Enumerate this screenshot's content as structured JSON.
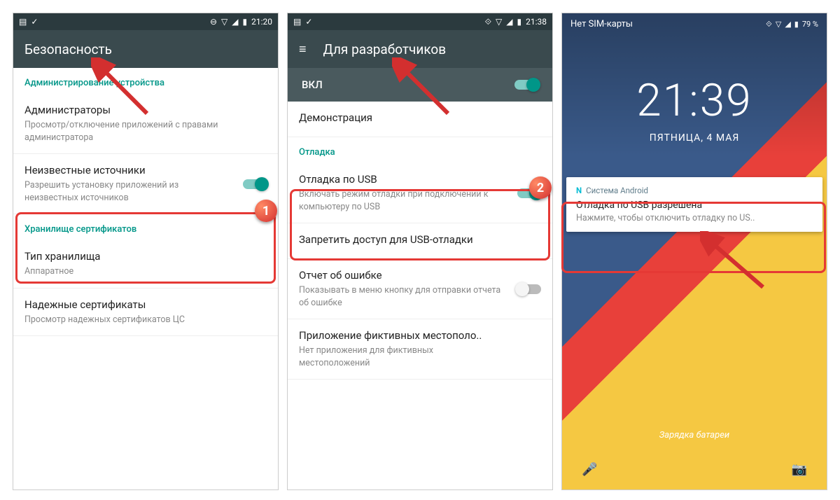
{
  "phone1": {
    "statusbar_time": "21:20",
    "header_title": "Безопасность",
    "section1": "Администрирование устройства",
    "item1_title": "Администраторы",
    "item1_sub": "Просмотр/отключение приложений с правами администратора",
    "item2_title": "Неизвестные источники",
    "item2_sub": "Разрешить установку приложений из неизвестных источников",
    "section2": "Хранилище сертификатов",
    "item3_title": "Тип хранилища",
    "item3_sub": "Аппаратное",
    "item4_title": "Надежные сертификаты",
    "item4_sub": "Просмотр надежных сертификатов ЦС"
  },
  "phone2": {
    "statusbar_time": "21:38",
    "header_title": "Для разработчиков",
    "toggle_label": "ВКЛ",
    "item0_title": "Демонстрация",
    "section1": "Отладка",
    "item1_title": "Отладка по USB",
    "item1_sub": "Включать режим отладки при подключении к компьютеру по USB",
    "item2_title": "Запретить доступ для USB-отладки",
    "item3_title": "Отчет об ошибке",
    "item3_sub": "Показывать в меню кнопку для отправки отчета об ошибке",
    "item4_title": "Приложение фиктивных местополо..",
    "item4_sub": "Нет приложения для фиктивных местоположений"
  },
  "phone3": {
    "sim_status": "Нет SIM-карты",
    "battery_pct": "79 %",
    "clock": "21:39",
    "date": "ПЯТНИЦА, 4 МАЯ",
    "notif_app": "Система Android",
    "notif_title": "Отладка по USB разрешена",
    "notif_sub": "Нажмите, чтобы отключить отладку по US..",
    "charging": "Зарядка батареи"
  },
  "badge1": "1",
  "badge2": "2"
}
